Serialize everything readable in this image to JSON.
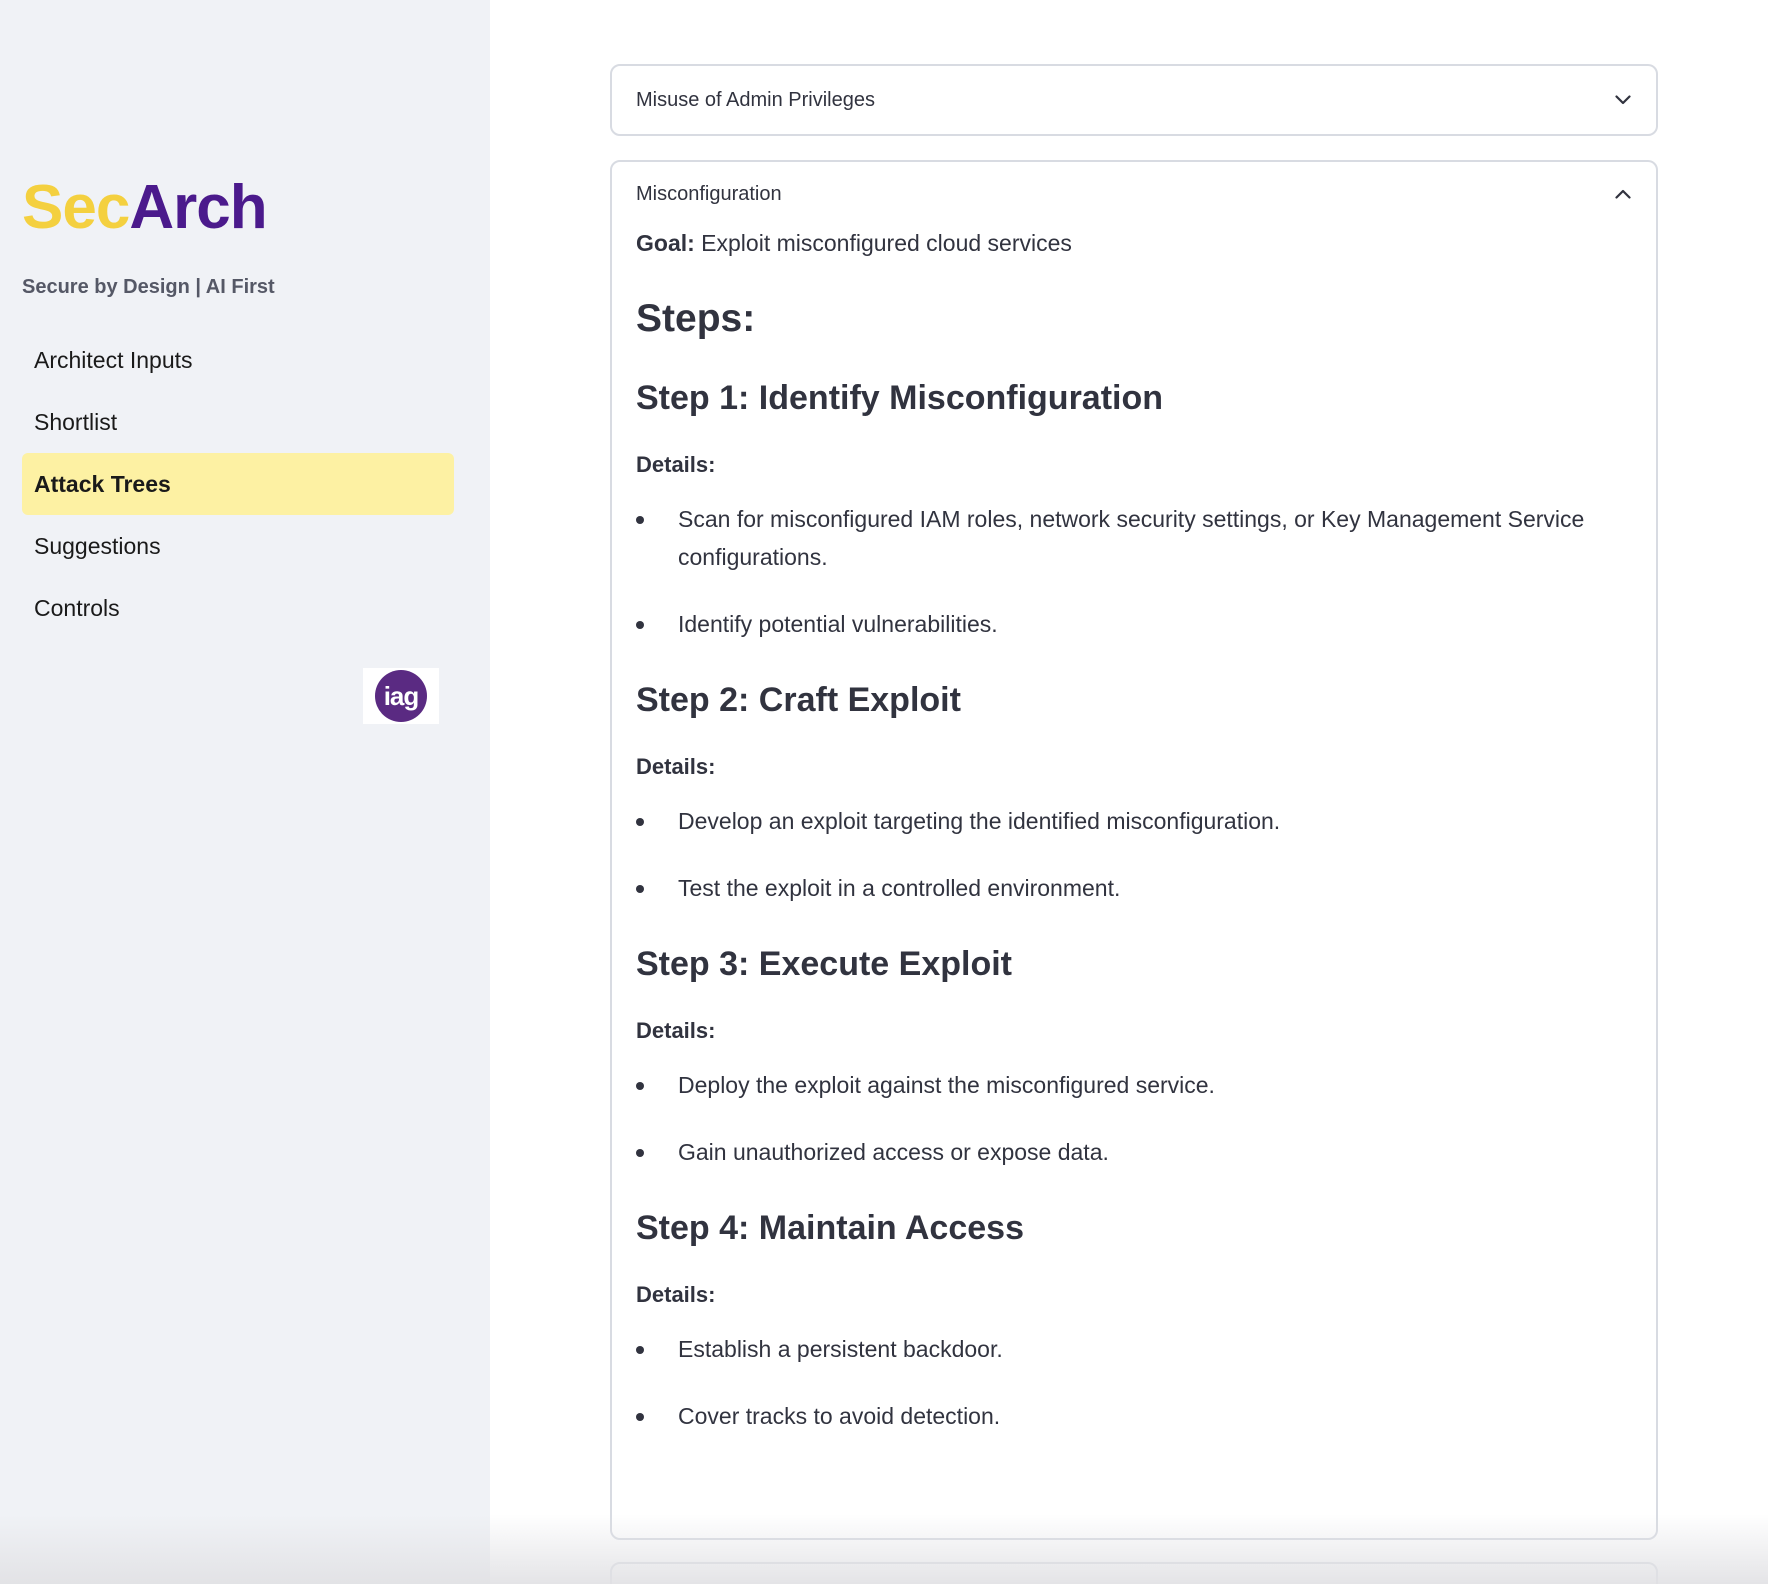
{
  "sidebar": {
    "logo": {
      "part1": "Sec",
      "part2": "Arch"
    },
    "tagline": "Secure by Design | AI First",
    "nav": [
      {
        "label": "Architect Inputs",
        "active": false
      },
      {
        "label": "Shortlist",
        "active": false
      },
      {
        "label": "Attack Trees",
        "active": true
      },
      {
        "label": "Suggestions",
        "active": false
      },
      {
        "label": "Controls",
        "active": false
      }
    ],
    "partner_logo_text": "iag"
  },
  "main": {
    "expanders": [
      {
        "title": "Misuse of Admin Privileges",
        "expanded": false
      },
      {
        "title": "Misconfiguration",
        "expanded": true,
        "goal_label": "Goal:",
        "goal_text": "Exploit misconfigured cloud services",
        "steps_heading": "Steps:",
        "details_label": "Details:",
        "steps": [
          {
            "title": "Step 1: Identify Misconfiguration",
            "details": [
              "Scan for misconfigured IAM roles, network security settings, or Key Management Service configurations.",
              "Identify potential vulnerabilities."
            ]
          },
          {
            "title": "Step 2: Craft Exploit",
            "details": [
              "Develop an exploit targeting the identified misconfiguration.",
              "Test the exploit in a controlled environment."
            ]
          },
          {
            "title": "Step 3: Execute Exploit",
            "details": [
              "Deploy the exploit against the misconfigured service.",
              "Gain unauthorized access or expose data."
            ]
          },
          {
            "title": "Step 4: Maintain Access",
            "details": [
              "Establish a persistent backdoor.",
              "Cover tracks to avoid detection."
            ]
          }
        ]
      }
    ]
  },
  "colors": {
    "logo_sec": "#f4d03f",
    "logo_arch": "#4b1a8c",
    "active_nav_bg": "#fdf1a3",
    "sidebar_bg": "#f0f2f6",
    "iag_purple": "#5a2a82"
  },
  "icons": {
    "collapsed": "chevron-down-icon",
    "expanded": "chevron-up-icon"
  }
}
